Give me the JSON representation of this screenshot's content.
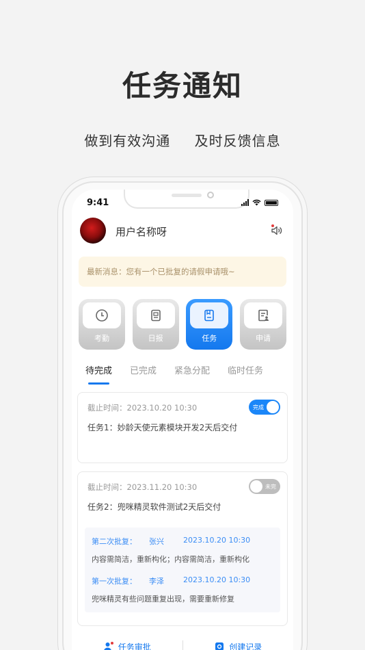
{
  "hero": {
    "title": "任务通知",
    "subtitle_left": "做到有效沟通",
    "subtitle_right": "及时反馈信息"
  },
  "status_bar": {
    "time": "9:41"
  },
  "user": {
    "name": "用户名称呀"
  },
  "notice": {
    "text": "最新消息：您有一个已批复的请假申请哦~"
  },
  "menu": [
    {
      "label": "考勤",
      "icon": "clock-icon",
      "active": false
    },
    {
      "label": "日报",
      "icon": "report-icon",
      "active": false
    },
    {
      "label": "任务",
      "icon": "task-icon",
      "active": true
    },
    {
      "label": "申请",
      "icon": "apply-icon",
      "active": false
    }
  ],
  "tabs": [
    {
      "label": "待完成",
      "active": true
    },
    {
      "label": "已完成",
      "active": false
    },
    {
      "label": "紧急分配",
      "active": false
    },
    {
      "label": "临时任务",
      "active": false
    }
  ],
  "tasks": [
    {
      "deadline_label": "截止时间：",
      "deadline": "2023.10.20  10:30",
      "title": "任务1：妙龄天使元素模块开发2天后交付",
      "toggle_label": "完成",
      "toggle_on": true
    },
    {
      "deadline_label": "截止时间：",
      "deadline": "2023.11.20  10:30",
      "title": "任务2：兜咪精灵软件测试2天后交付",
      "toggle_label": "未完",
      "toggle_on": false,
      "approvals": [
        {
          "stage": "第二次批复：",
          "person": "张兴",
          "time": "2023.10.20 10:30",
          "comment": "内容需简洁，重新构化；内容需简洁，重新构化"
        },
        {
          "stage": "第一次批复：",
          "person": "李泽",
          "time": "2023.10.20 10:30",
          "comment": "兜咪精灵有些问题重复出现，需要重新修复"
        }
      ]
    }
  ],
  "bottom": {
    "left_label": "任务审批",
    "right_label": "创建记录"
  },
  "colors": {
    "accent": "#1478ee",
    "notice_bg": "#fdf6e5",
    "notice_text": "#a9916a",
    "approval_blue": "#3b8df5"
  }
}
